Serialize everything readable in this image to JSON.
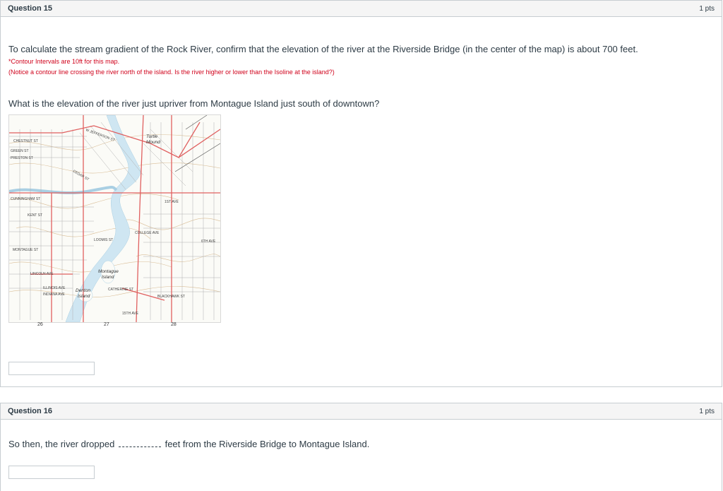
{
  "question15": {
    "title": "Question 15",
    "points": "1 pts",
    "intro": "To calculate the stream gradient of the Rock River, confirm that the elevation of the river at the Riverside Bridge (in the center of the map) is about 700 feet.",
    "note1": "*Contour Intervals are 10ft for this map.",
    "note2": "(Notice a contour line crossing the river north of the island. Is the river higher or lower than the Isoline at the island?)",
    "prompt": "What is the elevation of the river just upriver from Montague Island just south of downtown?",
    "map": {
      "labels": {
        "turtle": "Turtle",
        "mound": "Mound",
        "montague": "Montague",
        "island": "Island",
        "denton": "Denton",
        "denton_island": "Island",
        "montague_st": "MONTAGUE ST",
        "chestnut_st": "CHESTNUT ST",
        "jefferson_st": "W JEFFERSON ST",
        "lincoln_ave": "LINCOLN AVE",
        "illinois_ave": "ILLINOIS AVE",
        "indiana_ave": "INDIANA AVE",
        "first_ave": "1ST AVE",
        "sixth_ave": "6TH AVE",
        "college_ave": "COLLEGE AVE",
        "loomis_st": "LOOMIS ST",
        "catherine_st": "CATHERINE ST",
        "kent_st": "KENT ST",
        "green_st": "GREEN ST",
        "preston_st": "PRESTON ST",
        "cunningham_st": "CUNNINGHAM ST",
        "fifteenth_ave": "15TH AVE",
        "blackhawk_st": "BLACKHAWK ST",
        "cedar_st": "CEDAR ST"
      },
      "grid_labels": [
        "26",
        "27",
        "28"
      ],
      "colors": {
        "river": "#cfe6f2",
        "roads": "#e06060",
        "streets": "#9a9a9a",
        "contour": "#d4b48a"
      }
    },
    "answer_value": ""
  },
  "question16": {
    "title": "Question 16",
    "points": "1 pts",
    "text_before": "So then, the river dropped",
    "text_after": "feet from the Riverside Bridge to Montague Island.",
    "answer_value": ""
  }
}
